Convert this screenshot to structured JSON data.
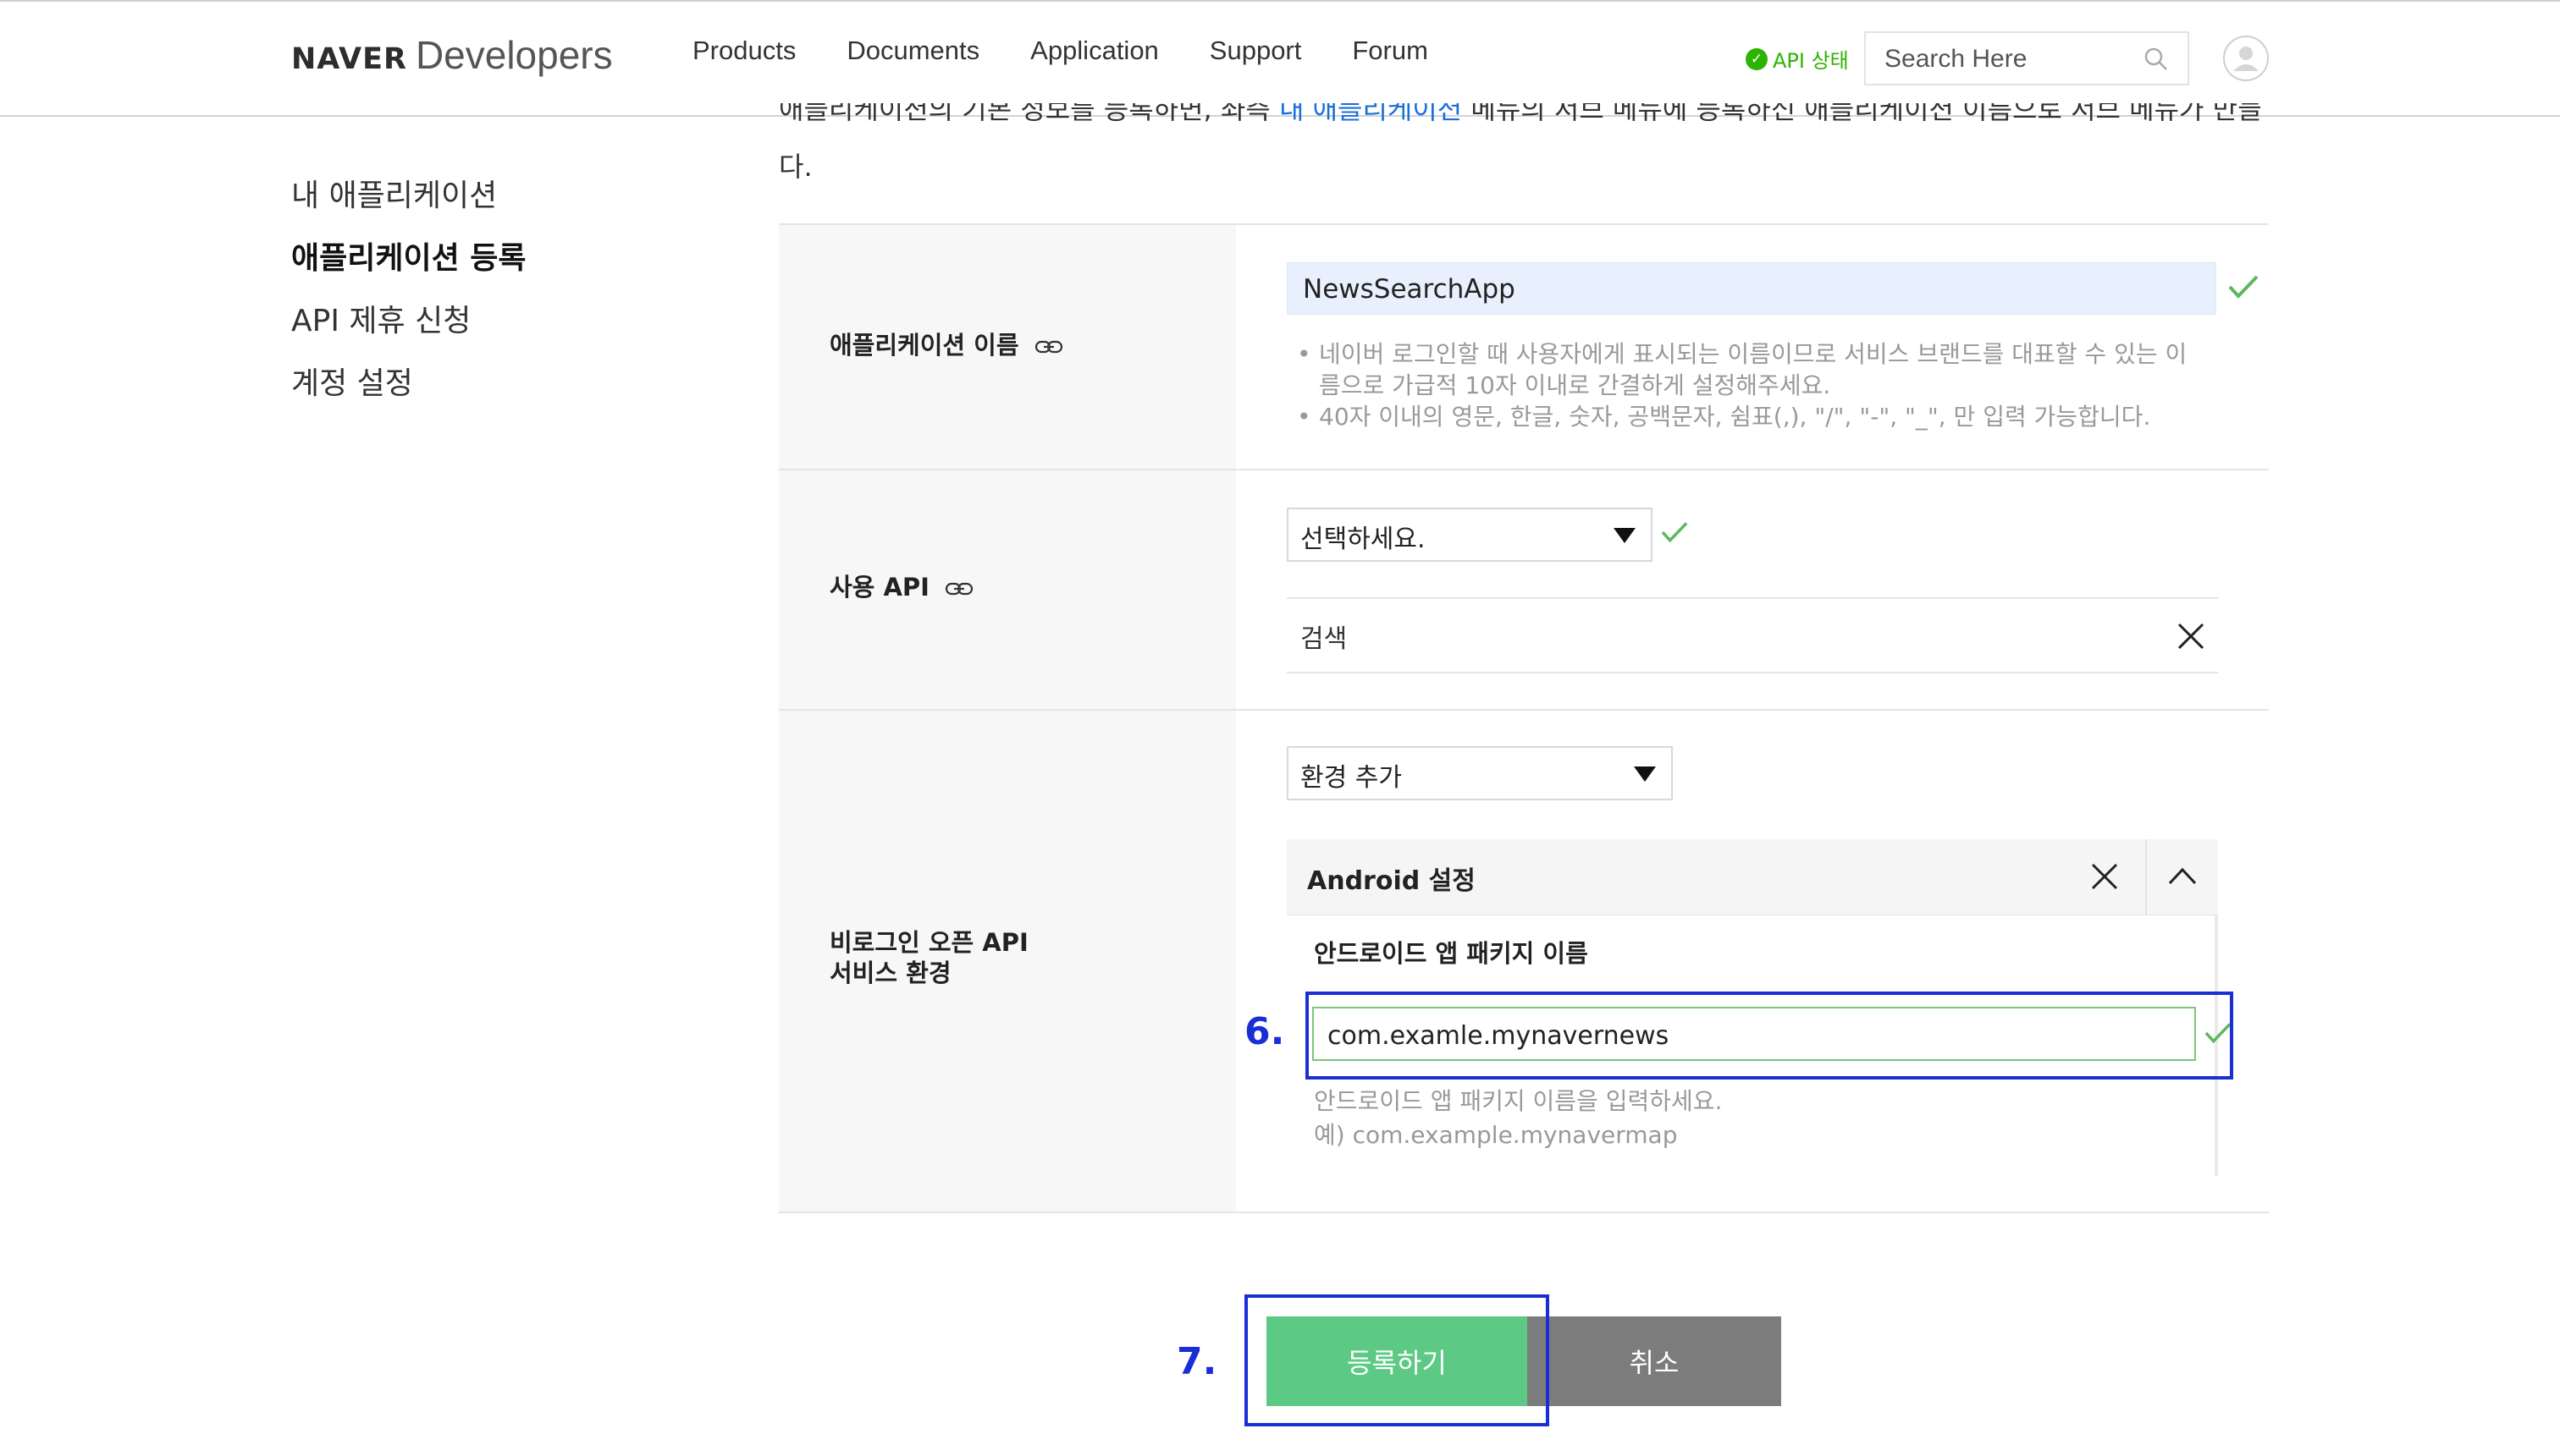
{
  "header": {
    "logo_brand": "NAVER",
    "logo_product": "Developers",
    "nav": [
      "Products",
      "Documents",
      "Application",
      "Support",
      "Forum"
    ],
    "api_status": "API 상태",
    "search_placeholder": "Search Here"
  },
  "sidebar": {
    "items": [
      {
        "label": "내 애플리케이션"
      },
      {
        "label": "애플리케이션 등록"
      },
      {
        "label": "API 제휴 신청"
      },
      {
        "label": "계정 설정"
      }
    ]
  },
  "intro": {
    "line1_before": "애플리케이션의 기본 정보를 등록하면, 좌측 ",
    "line1_link": "내 애플리케이션",
    "line1_after": " 메뉴의 서브 메뉴에 등록하신 애플리케이션 이름으로 서브 메뉴가 만들어집니",
    "line2": "다."
  },
  "form": {
    "app_name": {
      "label": "애플리케이션 이름",
      "value": "NewsSearchApp",
      "help": [
        "네이버 로그인할 때 사용자에게 표시되는 이름이므로 서비스 브랜드를 대표할 수 있는 이",
        "름으로 가급적 10자 이내로 간결하게 설정해주세요.",
        "40자 이내의 영문, 한글, 숫자, 공백문자, 쉼표(,), \"/\", \"-\", \"_\", 만 입력 가능합니다."
      ]
    },
    "api": {
      "label": "사용 API",
      "select_value": "선택하세요.",
      "selected_item": "검색"
    },
    "env": {
      "label_line1": "비로그인 오픈 API",
      "label_line2": "서비스 환경",
      "select_value": "환경 추가",
      "panel_title": "Android 설정",
      "package_label": "안드로이드 앱 패키지 이름",
      "package_value": "com.examle.mynavernews",
      "package_help1": "안드로이드 앱 패키지 이름을 입력하세요.",
      "package_help2": "예) com.example.mynavermap"
    }
  },
  "annotations": {
    "step6": "6.",
    "step7": "7.",
    "highlight_color": "#1a2ed6"
  },
  "buttons": {
    "register": "등록하기",
    "cancel": "취소"
  },
  "colors": {
    "brand_green": "#2db400",
    "register_button": "#5cc984",
    "cancel_button": "#7c7c7c",
    "link_blue": "#1a6fd8"
  }
}
